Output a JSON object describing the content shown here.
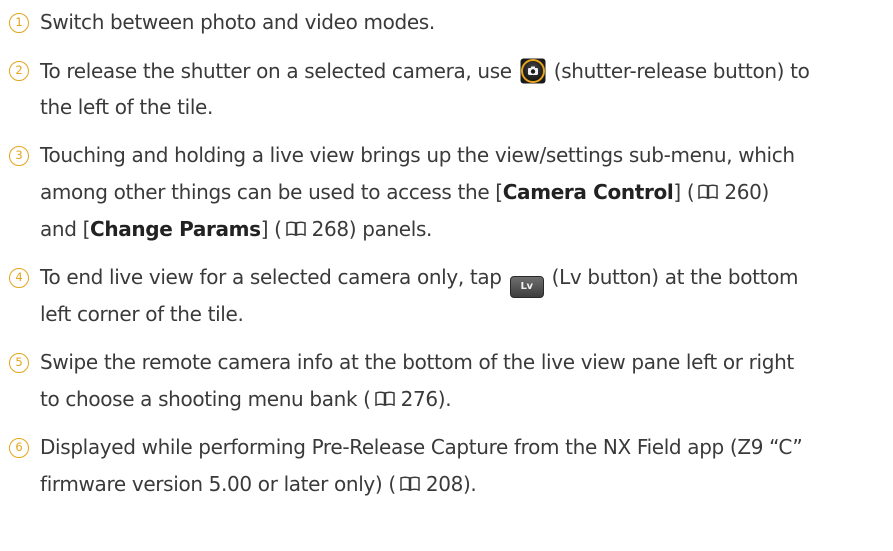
{
  "items": [
    {
      "number": "1",
      "lines": [
        [
          "Switch between photo and video modes."
        ]
      ]
    },
    {
      "number": "2",
      "text_a": "To release the shutter on a selected camera, use ",
      "icon": "shutter-release-button-icon",
      "text_b": " (shutter-release button) to",
      "text_c": "the left of the tile."
    },
    {
      "number": "3",
      "line1": "Touching and holding a live view brings up the view/settings sub-menu, which",
      "line2_a": "among other things can be used to access the [",
      "line2_bold": "Camera Control",
      "line2_b": "] (",
      "line2_page": "260)",
      "line3_a": "and [",
      "line3_bold": "Change Params",
      "line3_b": "] (",
      "line3_page": "268) panels."
    },
    {
      "number": "4",
      "text_a": "To end live view for a selected camera only, tap ",
      "icon_label": "Lv",
      "text_b": " (Lv button) at the bottom",
      "text_c": "left corner of the tile."
    },
    {
      "number": "5",
      "line1": "Swipe the remote camera info at the bottom of the live view pane left or right",
      "line2_a": "to choose a shooting menu bank (",
      "line2_page": "276)."
    },
    {
      "number": "6",
      "line1": "Displayed while performing Pre-Release Capture from the NX Field app (Z9 “C”",
      "line2_a": "firmware version 5.00 or later only) (",
      "line2_page": "208)."
    }
  ],
  "colors": {
    "number_accent": "#e3a51c",
    "text": "#3a3a3a",
    "bold_text": "#222222"
  },
  "icons": {
    "page_reference": "book-icon",
    "shutter": "shutter-release-button-icon",
    "lv": "lv-button-icon"
  }
}
